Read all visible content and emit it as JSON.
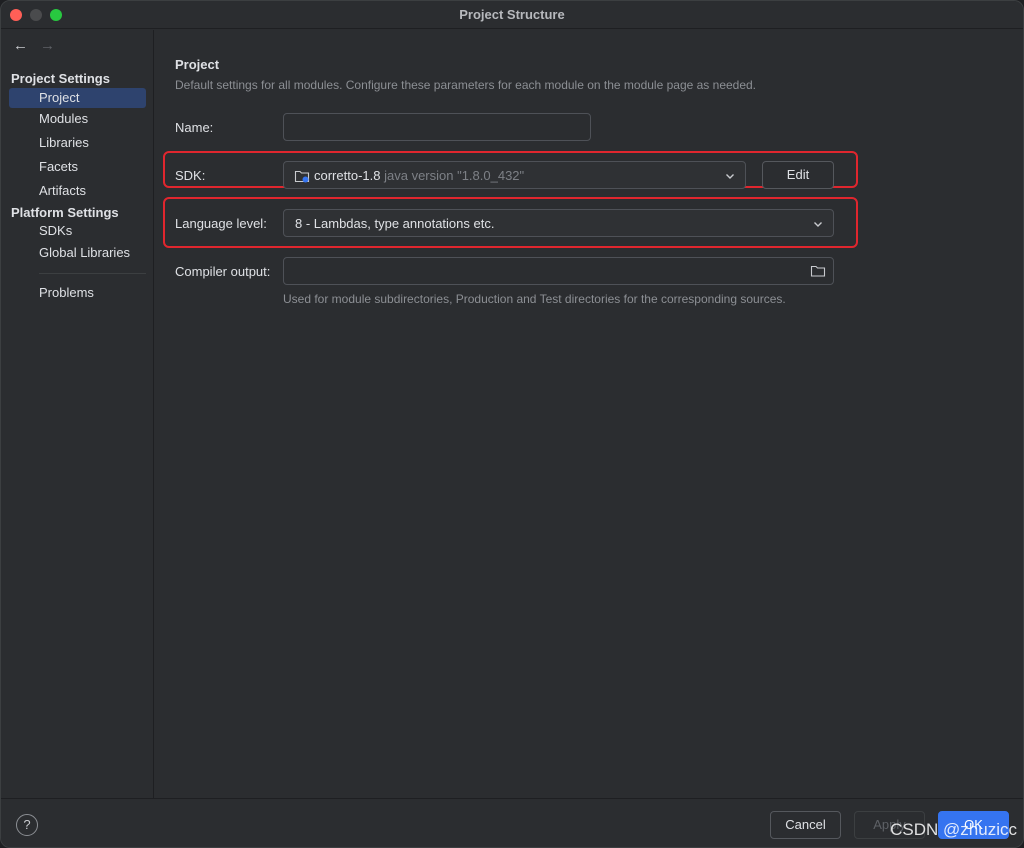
{
  "window": {
    "title": "Project Structure"
  },
  "sidebar": {
    "project_settings_heading": "Project Settings",
    "project_items": [
      {
        "label": "Project",
        "selected": true
      },
      {
        "label": "Modules"
      },
      {
        "label": "Libraries"
      },
      {
        "label": "Facets"
      },
      {
        "label": "Artifacts"
      }
    ],
    "platform_settings_heading": "Platform Settings",
    "platform_items": [
      {
        "label": "SDKs"
      },
      {
        "label": "Global Libraries"
      }
    ],
    "problems_label": "Problems"
  },
  "main": {
    "title": "Project",
    "description": "Default settings for all modules. Configure these parameters for each module on the module page as needed.",
    "name_label": "Name:",
    "name_value": "",
    "sdk_label": "SDK:",
    "sdk_value": "corretto-1.8",
    "sdk_detail": "java version \"1.8.0_432\"",
    "sdk_edit_label": "Edit",
    "language_level_label": "Language level:",
    "language_level_value": "8 - Lambdas, type annotations etc.",
    "compiler_output_label": "Compiler output:",
    "compiler_output_value": "",
    "compiler_output_hint": "Used for module subdirectories, Production and Test directories for the corresponding sources."
  },
  "footer": {
    "help_label": "?",
    "cancel_label": "Cancel",
    "apply_label": "Apply",
    "ok_label": "OK"
  },
  "watermark": "CSDN @zhuzicc",
  "colors": {
    "accent": "#3574f0",
    "selection": "#2e436e",
    "highlight_box": "#e0262e"
  }
}
